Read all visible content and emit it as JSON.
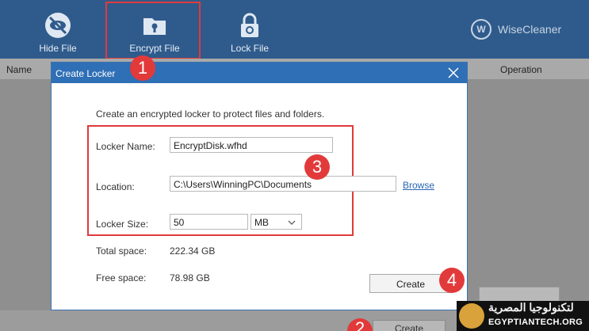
{
  "toolbar": {
    "hide_file": "Hide File",
    "encrypt_file": "Encrypt File",
    "lock_file": "Lock File",
    "brand": "WiseCleaner",
    "brand_logo": "W"
  },
  "table": {
    "col_name": "Name",
    "col_operation": "Operation"
  },
  "dialog": {
    "title": "Create Locker",
    "description": "Create an encrypted locker to protect files and folders.",
    "locker_name_label": "Locker Name:",
    "locker_name_value": "EncryptDisk.wfhd",
    "location_label": "Location:",
    "location_value": "C:\\Users\\WinningPC\\Documents",
    "browse": "Browse",
    "locker_size_label": "Locker Size:",
    "locker_size_value": "50",
    "size_unit": "MB",
    "total_space_label": "Total space:",
    "total_space_value": "222.34 GB",
    "free_space_label": "Free space:",
    "free_space_value": "78.98 GB",
    "create": "Create"
  },
  "steps": {
    "one": "1",
    "two": "2",
    "three": "3",
    "four": "4"
  },
  "bottom": {
    "create_button": "Create"
  },
  "watermark": {
    "arabic": "لتكنولوجيا المصرية",
    "english": "EGYPTIANTECH.ORG"
  },
  "colors": {
    "toolbar": "#2f5b8c",
    "titlebar": "#2f6fb5",
    "highlight": "#e03a3a",
    "link": "#2a66b6"
  },
  "icons": [
    "eye-slash-icon",
    "folder-lock-icon",
    "padlock-icon",
    "close-icon",
    "chevron-down-icon",
    "wisecleaner-logo"
  ]
}
